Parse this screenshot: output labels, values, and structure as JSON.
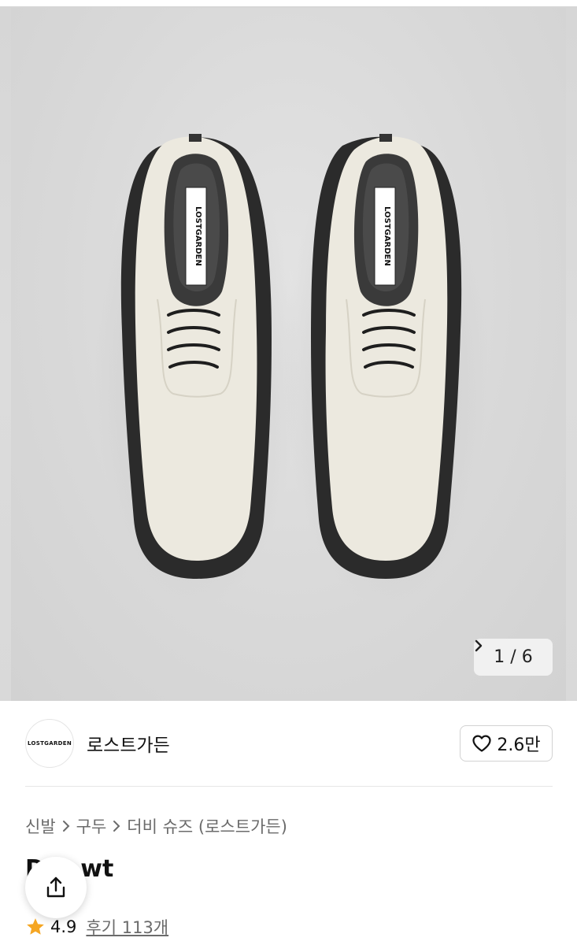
{
  "gallery": {
    "current": "1",
    "separator": "/",
    "total": "6",
    "next_icon": "chevron-right-icon",
    "insole_label": "LOSTGARDEN"
  },
  "shop": {
    "logo_text": "LOSTGARDEN",
    "name": "로스트가든",
    "like_icon": "heart-icon",
    "like_count": "2.6만"
  },
  "breadcrumb": [
    {
      "label": "신발"
    },
    {
      "label": "구두"
    },
    {
      "label": "더비 슈즈 (로스트가든)"
    }
  ],
  "product": {
    "title": "D k_wt"
  },
  "rating": {
    "star_icon": "star-icon",
    "value": "4.9",
    "review_label": "후기 113개"
  },
  "colors": {
    "star": "#f5a623",
    "shoe_upper": "#ece9df",
    "sole": "#2b2b2b"
  }
}
